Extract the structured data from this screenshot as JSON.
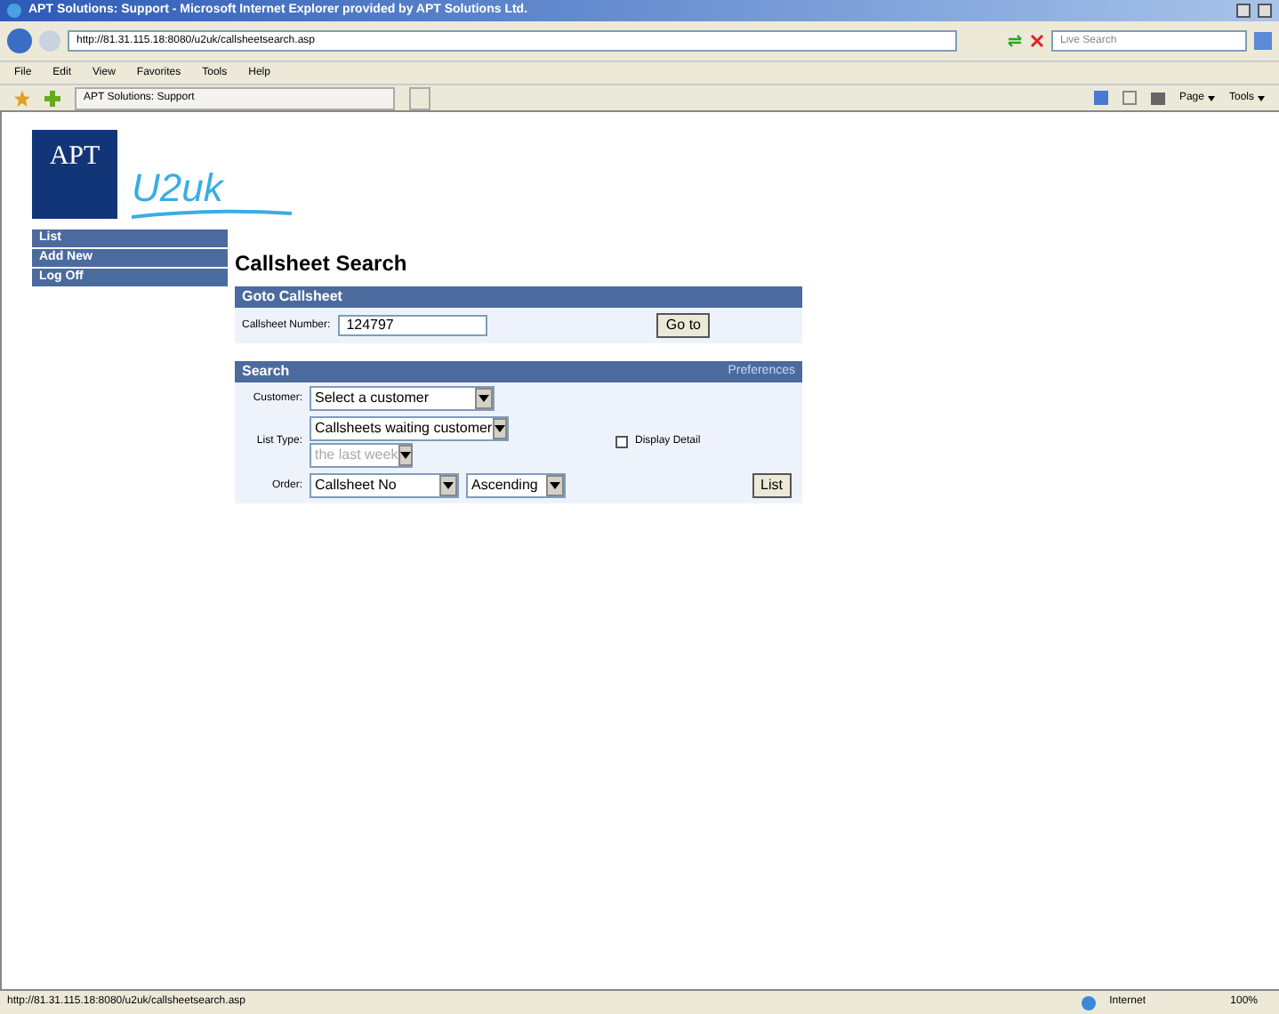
{
  "window": {
    "title": "APT Solutions: Support - Microsoft Internet Explorer provided by APT Solutions Ltd."
  },
  "address_bar": {
    "url": "http://81.31.115.18:8080/u2uk/callsheetsearch.asp",
    "search_placeholder": "Live Search"
  },
  "menu": [
    "File",
    "Edit",
    "View",
    "Favorites",
    "Tools",
    "Help"
  ],
  "tab": {
    "label": "APT Solutions: Support"
  },
  "toolbar": [
    "Page",
    "Tools"
  ],
  "logo": {
    "left": "APT",
    "right": "U2uk"
  },
  "nav": [
    "List",
    "Add New",
    "Log Off"
  ],
  "heading": "Callsheet Search",
  "goto": {
    "title": "Goto Callsheet",
    "label": "Callsheet Number:",
    "value": "124797",
    "button": "Go to"
  },
  "search": {
    "title": "Search",
    "link": "Preferences",
    "customer_label": "Customer:",
    "customer": "Select a customer",
    "list_type_label": "List Type:",
    "list_type": "Callsheets waiting customer",
    "period": "the last week",
    "period_disabled": true,
    "display_detail": {
      "label": "Display Detail",
      "checked": false
    },
    "order_label": "Order:",
    "order": "Callsheet No",
    "direction": "Ascending",
    "button": "List"
  },
  "status_bar": {
    "url": "http://81.31.115.18:8080/u2uk/callsheetsearch.asp",
    "zone": "Internet",
    "zoom": "100%"
  }
}
